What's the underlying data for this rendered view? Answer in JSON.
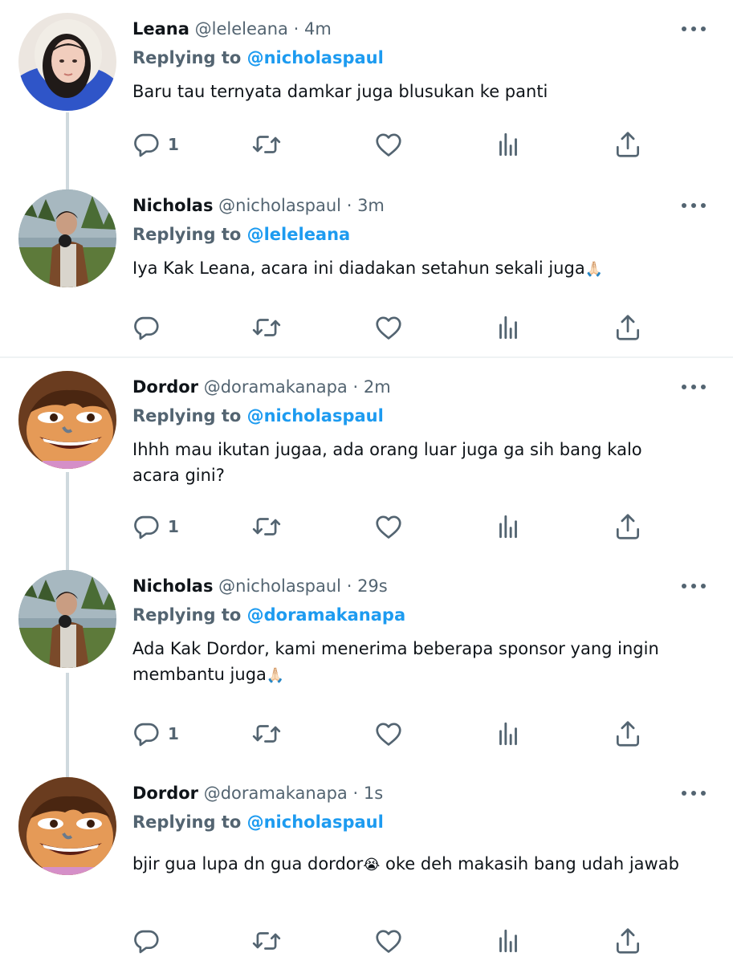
{
  "replying_to_label": "Replying to",
  "tweets": [
    {
      "name": "Leana",
      "handle": "@leleleana",
      "separator": "·",
      "time": "4m",
      "reply_to": "@nicholaspaul",
      "text": "Baru tau ternyata damkar juga blusukan ke panti",
      "reply_count": "1",
      "avatar": "avatar-leana"
    },
    {
      "name": "Nicholas",
      "handle": "@nicholaspaul",
      "separator": "·",
      "time": "3m",
      "reply_to": "@leleleana",
      "text": "Iya Kak Leana, acara ini diadakan setahun sekali juga",
      "text_emoji": "🙏🏻",
      "reply_count": "",
      "avatar": "avatar-nicholas"
    },
    {
      "name": "Dordor",
      "handle": "@doramakanapa",
      "separator": "·",
      "time": "2m",
      "reply_to": "@nicholaspaul",
      "text": "Ihhh mau ikutan jugaa, ada orang luar juga ga sih bang kalo acara gini?",
      "reply_count": "1",
      "avatar": "avatar-dordor"
    },
    {
      "name": "Nicholas",
      "handle": "@nicholaspaul",
      "separator": "·",
      "time": "29s",
      "reply_to": "@doramakanapa",
      "text": "Ada Kak Dordor, kami menerima beberapa sponsor yang ingin membantu juga",
      "text_emoji": "🙏🏻",
      "reply_count": "1",
      "avatar": "avatar-nicholas"
    },
    {
      "name": "Dordor",
      "handle": "@doramakanapa",
      "separator": "·",
      "time": "1s",
      "reply_to": "@nicholaspaul",
      "text": "bjir gua lupa dn gua dordor",
      "text_emoji": "😭",
      "text_after": " oke deh makasih bang udah jawab",
      "reply_count": "",
      "avatar": "avatar-dordor"
    }
  ],
  "icons": {
    "reply": "reply-icon",
    "retweet": "retweet-icon",
    "like": "like-icon",
    "views": "views-icon",
    "share": "share-icon",
    "more": "more-icon"
  },
  "colors": {
    "link": "#1d9bf0",
    "secondary": "#536471",
    "text": "#0f1419",
    "thread_line": "#cfd9de"
  }
}
